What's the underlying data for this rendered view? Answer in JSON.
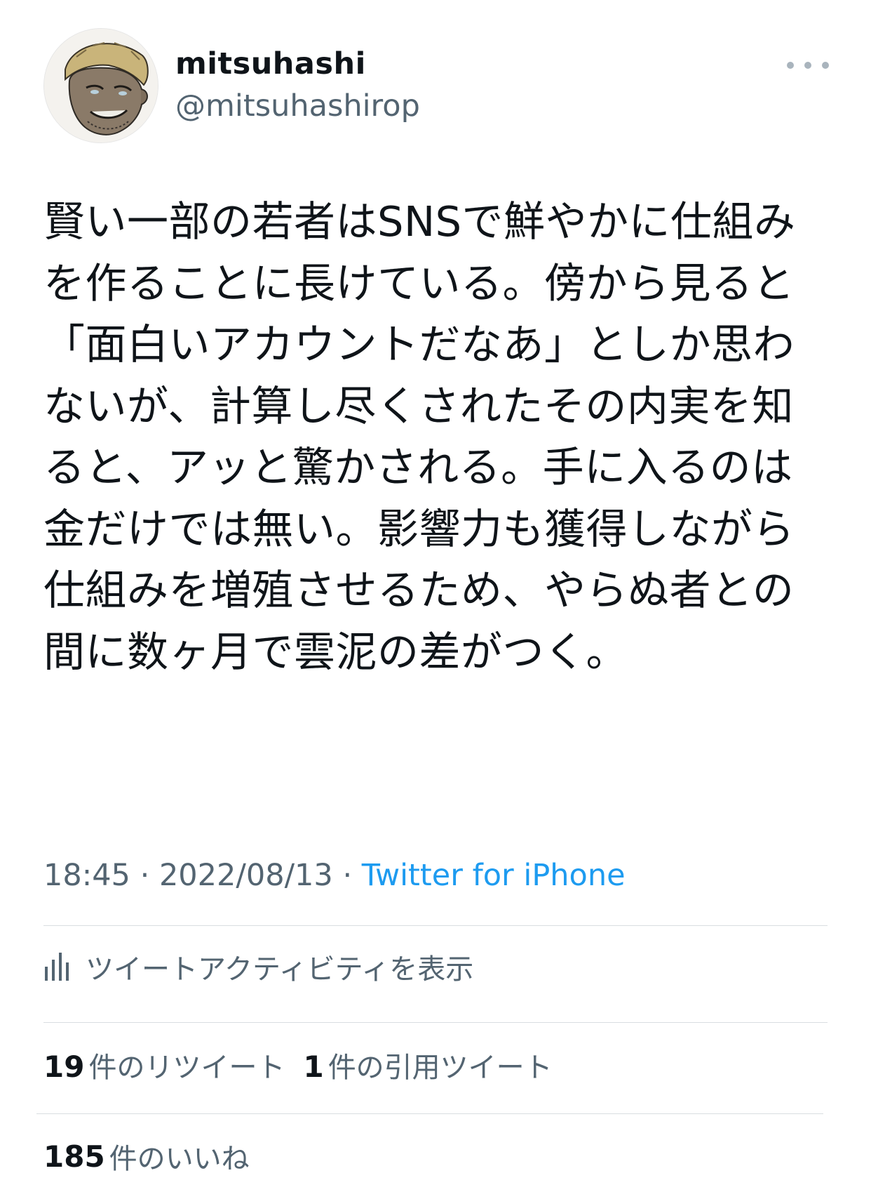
{
  "author": {
    "display_name": "mitsuhashi",
    "handle": "@mitsuhashirop"
  },
  "tweet": {
    "text": "賢い一部の若者はSNSで鮮やかに仕組みを作ることに長けている。傍から見ると「面白いアカウントだなあ」としか思わないが、計算し尽くされたその内実を知ると、アッと驚かされる。手に入るのは金だけでは無い。影響力も獲得しながら仕組みを増殖させるため、やらぬ者との間に数ヶ月で雲泥の差がつく。",
    "time": "18:45",
    "separator": "·",
    "date": "2022/08/13",
    "source": "Twitter for iPhone"
  },
  "activity": {
    "label": "ツイートアクティビティを表示"
  },
  "stats": {
    "retweets_count": "19",
    "retweets_label": "件のリツイート",
    "quotes_count": "1",
    "quotes_label": "件の引用ツイート",
    "likes_count": "185",
    "likes_label": "件のいいね"
  },
  "colors": {
    "text_primary": "#0f1419",
    "text_secondary": "#536471",
    "link": "#1d9bf0",
    "divider": "#d9dde1"
  },
  "icons": {
    "more": "more-horizontal-icon",
    "activity": "bar-chart-icon"
  }
}
